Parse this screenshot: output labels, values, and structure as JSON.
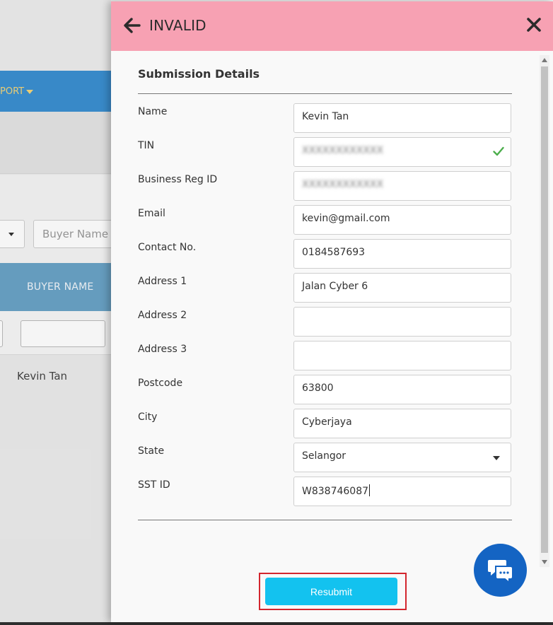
{
  "background": {
    "nav_label": "PORT",
    "buyer_name_placeholder": "Buyer Name",
    "table_header": "BUYER NAME",
    "row_buyer_name": "Kevin Tan"
  },
  "drawer": {
    "title": "INVALID",
    "section_title": "Submission Details",
    "header_color": "#f7a1b3",
    "fields": {
      "name": {
        "label": "Name",
        "value": "Kevin Tan"
      },
      "tin": {
        "label": "TIN",
        "value": "XXXXXXXXXXXX",
        "valid": true
      },
      "business_reg": {
        "label": "Business Reg ID",
        "value": "XXXXXXXXXXXX"
      },
      "email": {
        "label": "Email",
        "value": "kevin@gmail.com"
      },
      "contact": {
        "label": "Contact No.",
        "value": "0184587693"
      },
      "address1": {
        "label": "Address 1",
        "value": "Jalan Cyber 6"
      },
      "address2": {
        "label": "Address 2",
        "value": ""
      },
      "address3": {
        "label": "Address 3",
        "value": ""
      },
      "postcode": {
        "label": "Postcode",
        "value": "63800"
      },
      "city": {
        "label": "City",
        "value": "Cyberjaya"
      },
      "state": {
        "label": "State",
        "value": "Selangor"
      },
      "sst_id": {
        "label": "SST ID",
        "value": "W838746087"
      }
    },
    "resubmit_label": "Resubmit",
    "resubmit_color": "#13c2ef",
    "highlight_color": "#d3262e",
    "chat_color": "#1464c3"
  }
}
